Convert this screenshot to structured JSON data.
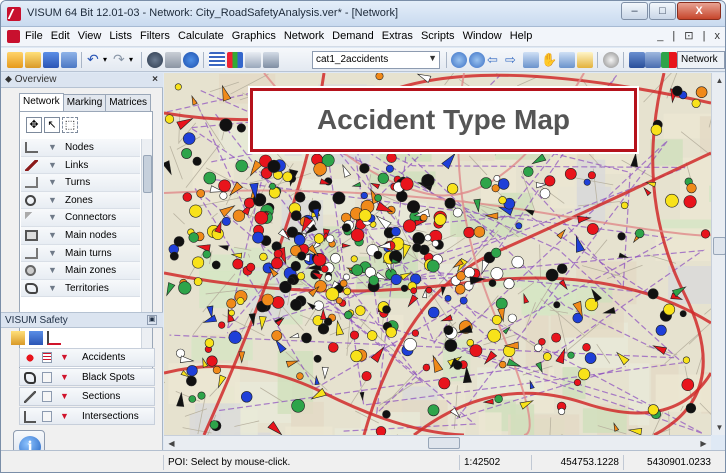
{
  "window": {
    "title": "VISUM 64 Bit 12.01-03 - Network: City_RoadSafetyAnalysis.ver* - [Network]",
    "controls": [
      "–",
      "□",
      "X"
    ]
  },
  "menubar": {
    "items": [
      "File",
      "Edit",
      "View",
      "Lists",
      "Filters",
      "Calculate",
      "Graphics",
      "Network",
      "Demand",
      "Extras",
      "Scripts",
      "Window",
      "Help"
    ],
    "mdi_controls": "_ | ⊡ | x"
  },
  "toolbar": {
    "parameter_set": "cat1_2accidents",
    "mode_label": "Network"
  },
  "overview": {
    "header": "Overview",
    "tabs": [
      "Network",
      "Marking",
      "Matrices"
    ],
    "layers": [
      "Nodes",
      "Links",
      "Turns",
      "Zones",
      "Connectors",
      "Main nodes",
      "Main turns",
      "Main zones",
      "Territories"
    ]
  },
  "safety": {
    "header": "VISUM Safety",
    "items": [
      "Accidents",
      "Black Spots",
      "Sections",
      "Intersections"
    ]
  },
  "map": {
    "title": "Accident Type Map"
  },
  "statusbar": {
    "message": "POI: Select by mouse-click.",
    "scale": "1:42502",
    "x": "454753.1228",
    "y": "5430901.0233"
  },
  "colors": {
    "accident_red": "#e8141c",
    "accident_green": "#2ea44a",
    "accident_yellow": "#f8e21a",
    "accident_blue": "#1e3fd8",
    "accident_black": "#111111",
    "accident_orange": "#f08a1a",
    "road_red": "#d02a2a",
    "title_border": "#b5121b"
  }
}
